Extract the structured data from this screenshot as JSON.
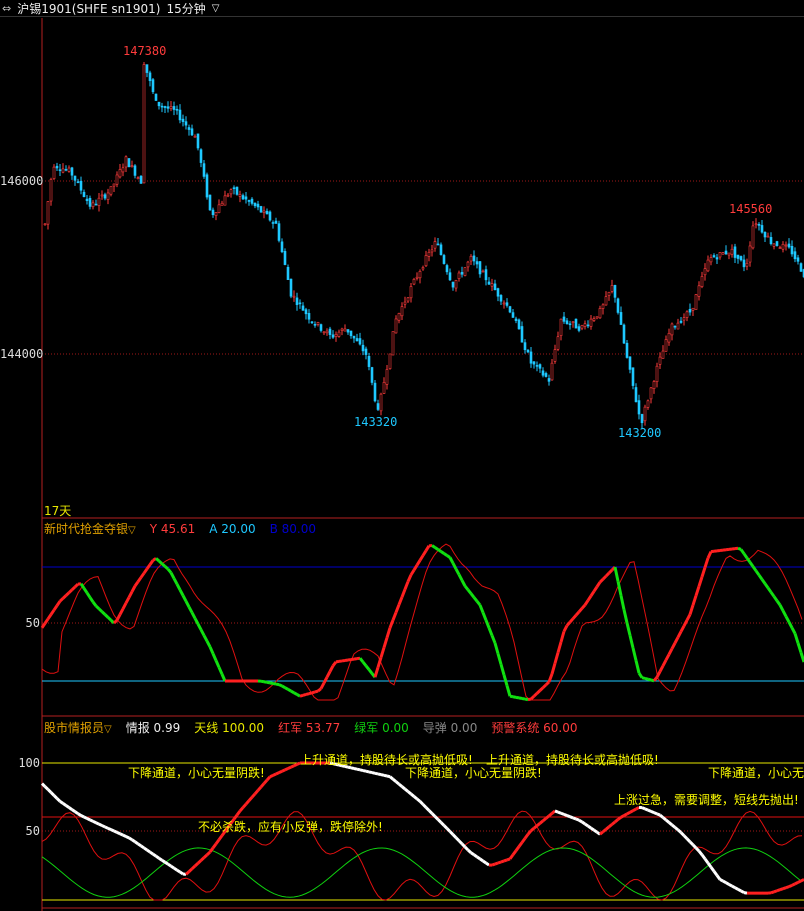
{
  "topbar": {
    "icon": "arrows-icon",
    "symbol": "沪锡1901(SHFE sn1901)",
    "period": "15分钟",
    "period_chevron": "chevron-down-icon"
  },
  "main_chart": {
    "axis_labels": [
      "146000",
      "144000"
    ],
    "high1": "147380",
    "high2": "145560",
    "low1": "143320",
    "low2": "143200",
    "days": "17天",
    "up_color": "#ff3c3c",
    "down_color": "#1ec8ff"
  },
  "indicator1": {
    "name": "新时代抢金夺银",
    "y_label": "Y 45.61",
    "a_label": "A 20.00",
    "b_label": "B 80.00",
    "axis_label": "50",
    "y_color": "#ff3c3c",
    "a_color": "#1ec8ff",
    "b_color": "#0000cc"
  },
  "indicator2": {
    "name": "股市情报员",
    "info": "情报 0.99",
    "tianxian": "天线 100.00",
    "hongjun": "红军 53.77",
    "lvjun": "绿军 0.00",
    "daodan": "导弹 0.00",
    "yujing": "预警系统 60.00",
    "axis_100": "100",
    "axis_50": "50",
    "msg_up1": "上升通道，持股待长或高抛低吸!",
    "msg_up2": "上升通道，持股待长或高抛低吸!",
    "msg_down1": "下降通道，小心无量阴跌!",
    "msg_down2": "下降通道，小心无量阴跌!",
    "msg_down3": "下降通道，小心无",
    "msg_rebound": "不必杀跌，应有小反弹，跌停除外!",
    "msg_overheat": "上涨过急，需要调整，短线先抛出!"
  }
}
